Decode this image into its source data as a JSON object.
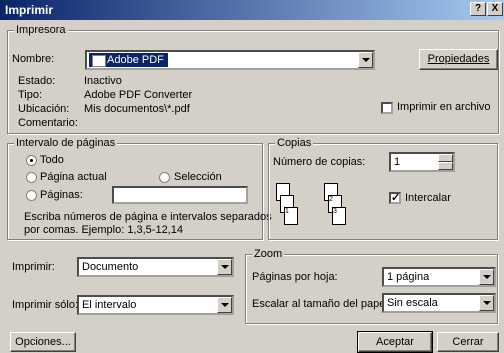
{
  "window": {
    "title": "Imprimir",
    "help": "?",
    "close": "X"
  },
  "printer": {
    "legend": "Impresora",
    "name_label": "Nombre:",
    "name_value": "Adobe PDF",
    "properties": "Propiedades",
    "status_label": "Estado:",
    "status_value": "Inactivo",
    "type_label": "Tipo:",
    "type_value": "Adobe PDF Converter",
    "location_label": "Ubicación:",
    "location_value": "Mis documentos\\*.pdf",
    "comment_label": "Comentario:",
    "print_to_file": "Imprimir en archivo"
  },
  "range": {
    "legend": "Intervalo de páginas",
    "all": "Todo",
    "current": "Página actual",
    "selection": "Selección",
    "pages": "Páginas:",
    "hint1": "Escriba números de página e intervalos separados",
    "hint2": "por comas. Ejemplo: 1,3,5-12,14"
  },
  "copies": {
    "legend": "Copias",
    "count_label": "Número de copias:",
    "count_value": "1",
    "collate": "Intercalar"
  },
  "print_what": {
    "label": "Imprimir:",
    "value": "Documento"
  },
  "print_only": {
    "label": "Imprimir sólo:",
    "value": "El intervalo"
  },
  "zoom": {
    "legend": "Zoom",
    "pages_label": "Páginas por hoja:",
    "pages_value": "1 página",
    "scale_label": "Escalar al tamaño del papel:",
    "scale_value": "Sin escala"
  },
  "buttons": {
    "options": "Opciones...",
    "ok": "Aceptar",
    "cancel": "Cerrar"
  },
  "pages_icons": {
    "p1": "1",
    "p2": "2",
    "p3": "3"
  }
}
